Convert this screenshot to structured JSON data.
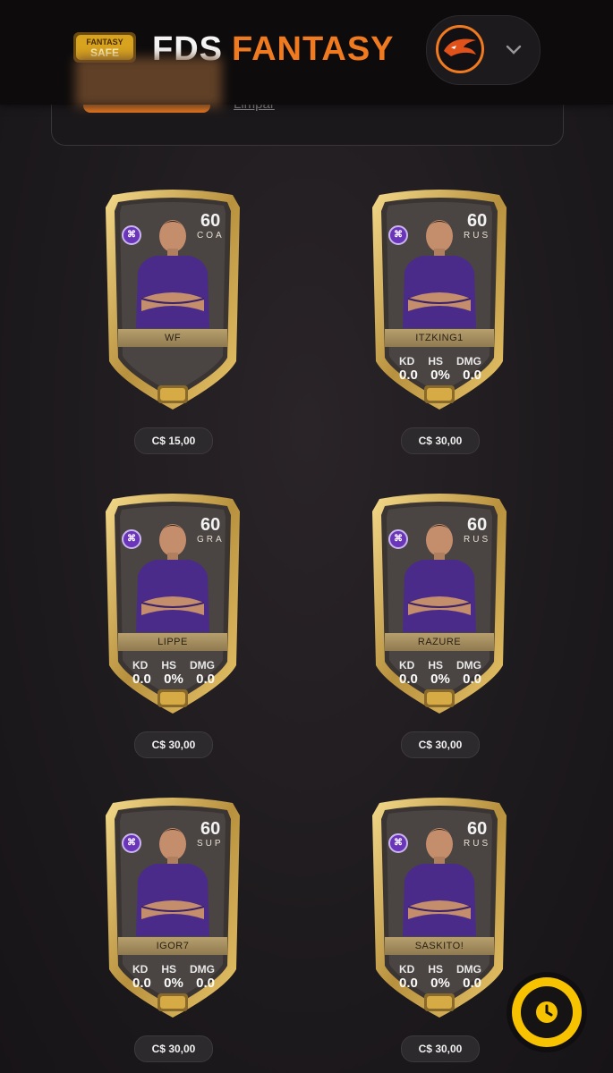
{
  "header": {
    "logo_alt": "FANTASY DA SAFE",
    "brand_first": "FDS",
    "brand_second": "FANTASY",
    "accent_color": "#f07a20"
  },
  "filters": {
    "clear_label": "Limpar"
  },
  "stat_labels": [
    "KD",
    "HS",
    "DMG"
  ],
  "cards": [
    {
      "rating": "60",
      "role": "COA",
      "name": "WF",
      "show_stats": false,
      "kd": "",
      "hs": "",
      "dmg": "",
      "price": "C$ 15,00",
      "shirt": "#4b2b8a"
    },
    {
      "rating": "60",
      "role": "RUS",
      "name": "ITZKING1",
      "show_stats": true,
      "kd": "0.0",
      "hs": "0%",
      "dmg": "0.0",
      "price": "C$ 30,00",
      "shirt": "#4b2b8a"
    },
    {
      "rating": "60",
      "role": "GRA",
      "name": "LIPPE",
      "show_stats": true,
      "kd": "0.0",
      "hs": "0%",
      "dmg": "0.0",
      "price": "C$ 30,00",
      "shirt": "#4b2b8a"
    },
    {
      "rating": "60",
      "role": "RUS",
      "name": "RAZURE",
      "show_stats": true,
      "kd": "0.0",
      "hs": "0%",
      "dmg": "0.0",
      "price": "C$ 30,00",
      "shirt": "#4b2b8a"
    },
    {
      "rating": "60",
      "role": "SUP",
      "name": "IGOR7",
      "show_stats": true,
      "kd": "0.0",
      "hs": "0%",
      "dmg": "0.0",
      "price": "C$ 30,00",
      "shirt": "#4b2b8a"
    },
    {
      "rating": "60",
      "role": "RUS",
      "name": "SASKITO!",
      "show_stats": true,
      "kd": "0.0",
      "hs": "0%",
      "dmg": "0.0",
      "price": "C$ 30,00",
      "shirt": "#4b2b8a"
    }
  ],
  "fab": {
    "icon": "clock-icon",
    "color": "#f7c200"
  }
}
